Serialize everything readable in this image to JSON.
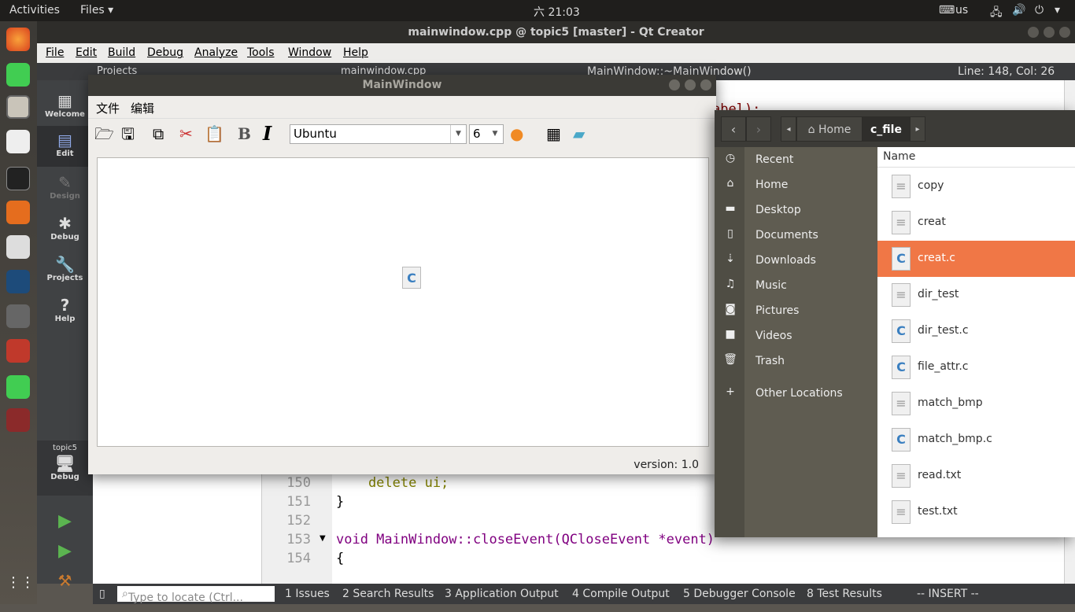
{
  "topbar": {
    "activities": "Activities",
    "app_menu": "Files ▾",
    "clock": "六 21:03",
    "keyboard": "us"
  },
  "qtcreator": {
    "title": "mainwindow.cpp @ topic5 [master] - Qt Creator",
    "menu": [
      "File",
      "Edit",
      "Build",
      "Debug",
      "Analyze",
      "Tools",
      "Window",
      "Help"
    ],
    "toolbar": {
      "projects": "Projects",
      "file": "mainwindow.cpp",
      "symbol": "MainWindow::~MainWindow()",
      "position": "Line: 148, Col: 26"
    },
    "modes": [
      "Welcome",
      "Edit",
      "Design",
      "Debug",
      "Projects",
      "Help"
    ],
    "kit": {
      "project": "topic5",
      "config": "Debug"
    },
    "code_fragment": "abel);",
    "lines": [
      {
        "n": "150",
        "code": "    delete ui;"
      },
      {
        "n": "151",
        "code": "}"
      },
      {
        "n": "152",
        "code": ""
      },
      {
        "n": "153",
        "code": "void MainWindow::closeEvent(QCloseEvent *event)"
      },
      {
        "n": "154",
        "code": "{"
      }
    ],
    "status": {
      "locate_placeholder": "Type to locate (Ctrl...",
      "tabs": [
        "1 Issues",
        "2 Search Results",
        "3 Application Output",
        "4 Compile Output",
        "5 Debugger Console",
        "8 Test Results"
      ],
      "mode": "-- INSERT --"
    }
  },
  "mainwindow": {
    "title": "MainWindow",
    "menu": [
      "文件",
      "编辑"
    ],
    "font": "Ubuntu",
    "size": "6",
    "version": "version: 1.0"
  },
  "files": {
    "breadcrumb": [
      "Home",
      "c_file"
    ],
    "sidebar": [
      "Recent",
      "Home",
      "Desktop",
      "Documents",
      "Downloads",
      "Music",
      "Pictures",
      "Videos",
      "Trash",
      "Other Locations"
    ],
    "column": "Name",
    "items": [
      {
        "name": "copy",
        "type": "text"
      },
      {
        "name": "creat",
        "type": "text"
      },
      {
        "name": "creat.c",
        "type": "c",
        "selected": true
      },
      {
        "name": "dir_test",
        "type": "text"
      },
      {
        "name": "dir_test.c",
        "type": "c"
      },
      {
        "name": "file_attr.c",
        "type": "c"
      },
      {
        "name": "match_bmp",
        "type": "text"
      },
      {
        "name": "match_bmp.c",
        "type": "c"
      },
      {
        "name": "read.txt",
        "type": "text"
      },
      {
        "name": "test.txt",
        "type": "text"
      }
    ],
    "accent": "#f07746"
  }
}
